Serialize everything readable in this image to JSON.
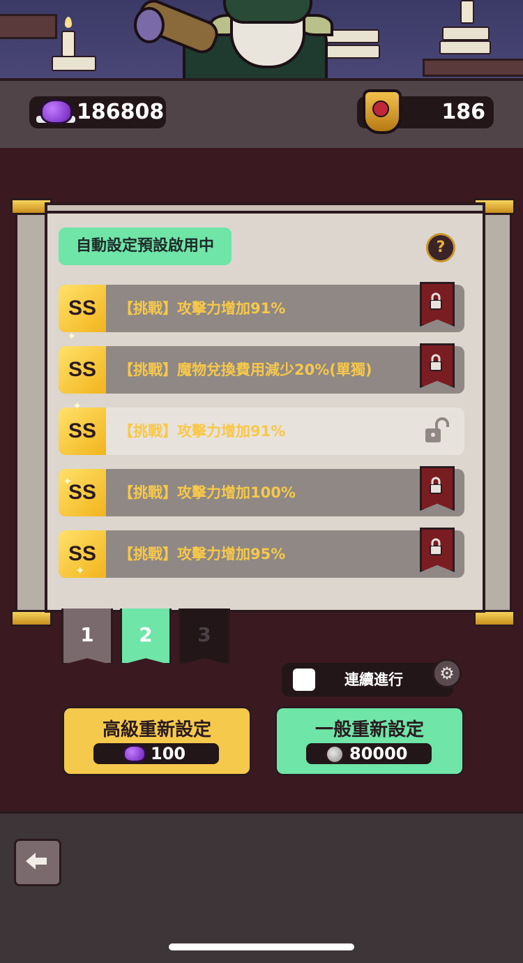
{
  "currency": {
    "gems": "186808",
    "trophies": "186"
  },
  "auto_preset_label": "自動設定預設啟用中",
  "help_label": "?",
  "options": [
    {
      "grade": "SS",
      "text": "【挑戰】攻擊力增加91%",
      "locked": true
    },
    {
      "grade": "SS",
      "text": "【挑戰】魔物兌換費用減少20%(單獨)",
      "locked": true
    },
    {
      "grade": "SS",
      "text": "【挑戰】攻擊力增加91%",
      "locked": false
    },
    {
      "grade": "SS",
      "text": "【挑戰】攻擊力增加100%",
      "locked": true
    },
    {
      "grade": "SS",
      "text": "【挑戰】攻擊力增加95%",
      "locked": true
    }
  ],
  "preset_tabs": [
    "1",
    "2",
    "3"
  ],
  "selected_tab": "2",
  "continuous_label": "連續進行",
  "advanced_reset": {
    "label": "高級重新設定",
    "cost": "100"
  },
  "normal_reset": {
    "label": "一般重新設定",
    "cost": "80000"
  },
  "colors": {
    "accent_green": "#6fe5a8",
    "accent_gold": "#f5c94c",
    "lock_red": "#7a1d22",
    "text_gold": "#f7c84a"
  },
  "icons": [
    "gem-icon",
    "trophy-crest-icon",
    "help-icon",
    "lock-icon",
    "unlock-icon",
    "gear-icon",
    "coin-icon",
    "back-arrow-icon"
  ]
}
